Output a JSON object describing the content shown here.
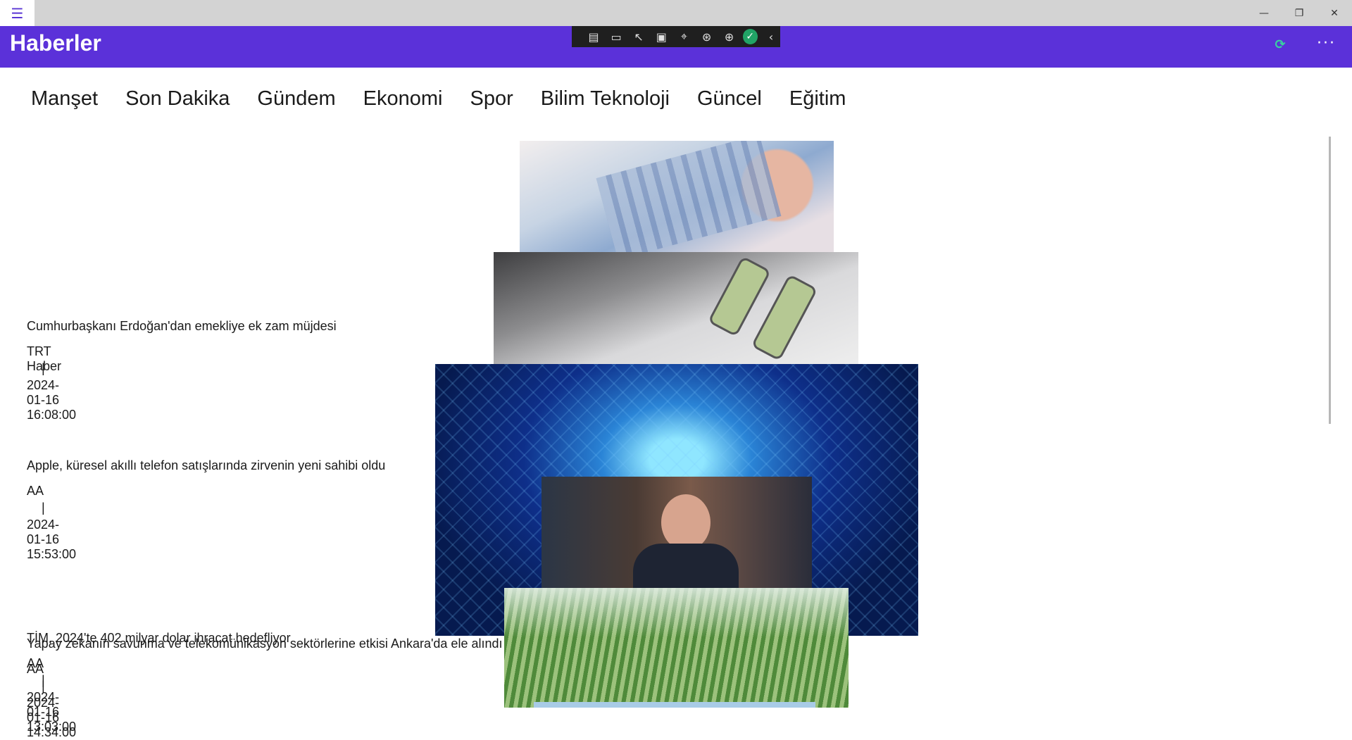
{
  "app": {
    "title": "Haberler"
  },
  "window": {
    "minimize": "—",
    "restore": "❐",
    "close": "✕"
  },
  "header": {
    "more": "···"
  },
  "categories": [
    "Manşet",
    "Son Dakika",
    "Gündem",
    "Ekonomi",
    "Spor",
    "Bilim Teknoloji",
    "Güncel",
    "Eğitim"
  ],
  "news": [
    {
      "title": "Cumhurbaşkanı Erdoğan'dan emekliye ek zam müjdesi",
      "source": "TRT Haber",
      "sep": "|",
      "date": "2024-01-16 16:08:00"
    },
    {
      "title": "Apple, küresel akıllı telefon satışlarında zirvenin yeni sahibi oldu",
      "source": "AA",
      "sep": "|",
      "date": "2024-01-16 15:53:00"
    },
    {
      "title": "TİM, 2024'te 402 milyar dolar ihracat hedefliyor",
      "source": "AA",
      "sep": "|",
      "date": "2024-01-16 13:03:00"
    },
    {
      "title": "Yapay zekanın savunma ve telekomünikasyon sektörlerine etkisi Ankara'da ele alındı",
      "source": "AA",
      "sep": "|",
      "date": "2024-01-16 14:34:00"
    }
  ],
  "colors": {
    "header": "#5b31d9",
    "titlebar": "#d3d3d3",
    "sync": "#38d39f"
  },
  "icons": [
    "hamburger-icon",
    "sync-icon",
    "more-icon"
  ]
}
